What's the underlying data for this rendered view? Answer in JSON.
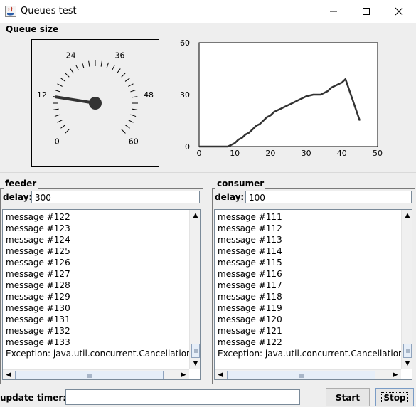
{
  "window": {
    "title": "Queues test",
    "minimize_icon": "minimize-icon",
    "maximize_icon": "maximize-icon",
    "close_icon": "close-icon"
  },
  "queue_size": {
    "label": "Queue size",
    "gauge": {
      "ticks": [
        "0",
        "12",
        "24",
        "36",
        "48",
        "60"
      ],
      "value": 12,
      "min": 0,
      "max": 60
    }
  },
  "chart_data": {
    "type": "line",
    "title": "",
    "xlabel": "",
    "ylabel": "",
    "xlim": [
      0,
      50
    ],
    "ylim": [
      0,
      60
    ],
    "x_ticks": [
      "0",
      "10",
      "20",
      "30",
      "40",
      "50"
    ],
    "y_ticks": [
      "0",
      "30",
      "60"
    ],
    "grid": false,
    "series": [
      {
        "x": [
          0,
          8,
          9,
          10,
          11,
          12,
          13,
          14,
          15,
          16,
          17,
          18,
          19,
          20,
          21,
          22,
          23,
          24,
          25,
          26,
          27,
          28,
          30,
          32,
          34,
          35,
          36,
          37,
          38,
          39,
          40,
          41,
          45
        ],
        "values": [
          0,
          0,
          1,
          2,
          4,
          5,
          7,
          8,
          10,
          12,
          13,
          15,
          17,
          18,
          20,
          21,
          22,
          23,
          24,
          25,
          26,
          27,
          29,
          30,
          30,
          31,
          32,
          34,
          35,
          36,
          37,
          39,
          15
        ]
      }
    ]
  },
  "feeder": {
    "title": "feeder",
    "delay_label": "delay:",
    "delay_value": "300",
    "messages": [
      "message #122",
      "message #123",
      "message #124",
      "message #125",
      "message #126",
      "message #127",
      "message #128",
      "message #129",
      "message #130",
      "message #131",
      "message #132",
      "message #133",
      "Exception: java.util.concurrent.CancellationExce"
    ]
  },
  "consumer": {
    "title": "consumer",
    "delay_label": "delay:",
    "delay_value": "100",
    "messages": [
      "message #111",
      "message #112",
      "message #113",
      "message #114",
      "message #115",
      "message #116",
      "message #117",
      "message #118",
      "message #119",
      "message #120",
      "message #121",
      "message #122",
      "Exception: java.util.concurrent.CancellationExce"
    ]
  },
  "footer": {
    "update_timer_label": "update timer:",
    "update_timer_value": "",
    "start_label": "Start",
    "stop_label": "Stop"
  }
}
